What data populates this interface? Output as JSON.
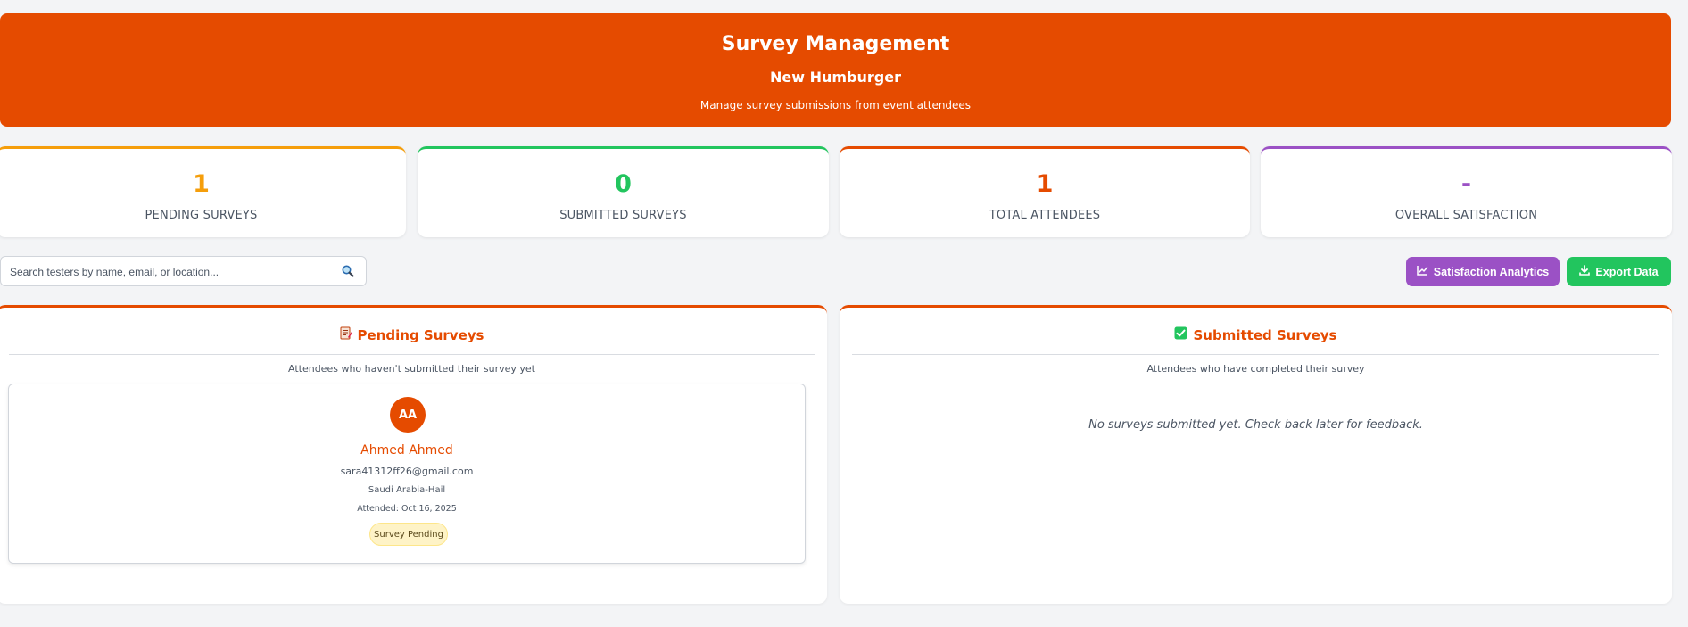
{
  "header": {
    "title": "Survey Management",
    "subtitle": "New Humburger",
    "description": "Manage survey submissions from event attendees",
    "color": "#e54b00"
  },
  "stats": [
    {
      "value": "1",
      "label": "PENDING SURVEYS",
      "color": "#f59e0b"
    },
    {
      "value": "0",
      "label": "SUBMITTED SURVEYS",
      "color": "#22c55e"
    },
    {
      "value": "1",
      "label": "TOTAL ATTENDEES",
      "color": "#e54b00"
    },
    {
      "value": "-",
      "label": "OVERALL SATISFACTION",
      "color": "#9b51c5"
    }
  ],
  "search": {
    "placeholder": "Search testers by name, email, or location...",
    "icon": "search-icon"
  },
  "actions": {
    "analytics_label": "Satisfaction Analytics",
    "analytics_icon": "chart-icon",
    "export_label": "Export Data",
    "export_icon": "download-icon"
  },
  "pending": {
    "title": "Pending Surveys",
    "icon": "memo-icon",
    "description": "Attendees who haven't submitted their survey yet",
    "items": [
      {
        "initials": "AA",
        "name": "Ahmed Ahmed",
        "email": "sara41312ff26@gmail.com",
        "location": "Saudi Arabia-Hail",
        "attended": "Attended: Oct 16, 2025",
        "status": "Survey Pending"
      }
    ]
  },
  "submitted": {
    "title": "Submitted Surveys",
    "icon": "check-box-icon",
    "description": "Attendees who have completed their survey",
    "empty_message": "No surveys submitted yet. Check back later for feedback."
  }
}
